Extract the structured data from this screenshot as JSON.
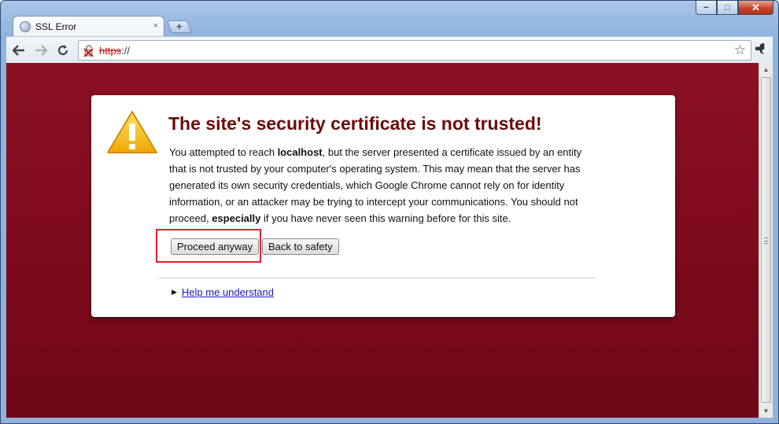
{
  "tab": {
    "title": "SSL Error",
    "close_glyph": "×",
    "new_tab_glyph": "+"
  },
  "toolbar": {
    "url_scheme": "https",
    "url_rest": "://",
    "star_icon": "☆",
    "wrench_icon": "🔧"
  },
  "window_controls": {
    "minimize": "−",
    "maximize": "□",
    "close": "✕"
  },
  "warning": {
    "heading": "The site's security certificate is not trusted!",
    "p1": "You attempted to reach ",
    "host": "localhost",
    "p2": ", but the server presented a certificate issued by an entity that is not trusted by your computer's operating system. This may mean that the server has generated its own security credentials, which Google Chrome cannot rely on for identity information, or an attacker may be trying to intercept your communications. You should not proceed, ",
    "emphasis": "especially",
    "p3": " if you have never seen this warning before for this site.",
    "proceed_label": "Proceed anyway",
    "back_label": "Back to safety",
    "help_label": "Help me understand"
  },
  "colors": {
    "page_background": "#7d0a1d",
    "heading": "#6b0a0a",
    "highlight_box": "#e3202e",
    "link": "#1a1ac4"
  }
}
